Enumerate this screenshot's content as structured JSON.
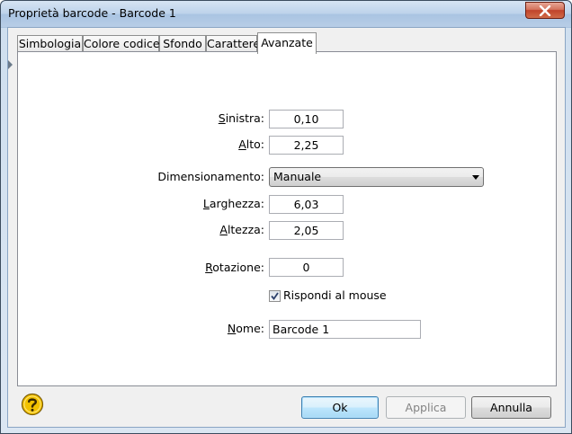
{
  "window": {
    "title": "Proprietà barcode - Barcode 1"
  },
  "tabs": [
    {
      "label": "Simbologia",
      "active": false
    },
    {
      "label": "Colore codice",
      "active": false
    },
    {
      "label": "Sfondo",
      "active": false
    },
    {
      "label": "Carattere",
      "active": false
    },
    {
      "label": "Avanzate",
      "active": true
    }
  ],
  "form": {
    "sinistra": {
      "label_u": "S",
      "label_rest": "inistra:",
      "value": "0,10"
    },
    "alto": {
      "label_u": "A",
      "label_rest": "lto:",
      "value": "2,25"
    },
    "dimensionamento": {
      "label": "Dimensionamento:",
      "value": "Manuale"
    },
    "larghezza": {
      "label_u": "L",
      "label_rest": "arghezza:",
      "value": "6,03"
    },
    "altezza": {
      "label_u": "A",
      "label_rest": "ltezza:",
      "value": "2,05"
    },
    "rotazione": {
      "label_u": "R",
      "label_rest": "otazione:",
      "value": "0"
    },
    "rispondi": {
      "label": "Rispondi al mouse",
      "checked": true
    },
    "nome": {
      "label_u": "N",
      "label_rest": "ome:",
      "value": "Barcode 1"
    }
  },
  "buttons": {
    "ok": "Ok",
    "applica": "Applica",
    "annulla": "Annulla"
  },
  "icons": {
    "help": "help-icon",
    "close": "close-icon",
    "dropdown": "chevron-down-icon",
    "check": "check-icon"
  },
  "colors": {
    "title_gradient_top": "#d6e4f3",
    "close_red": "#c0432a",
    "default_button_border": "#3c7fb1",
    "help_yellow": "#f2c200"
  }
}
